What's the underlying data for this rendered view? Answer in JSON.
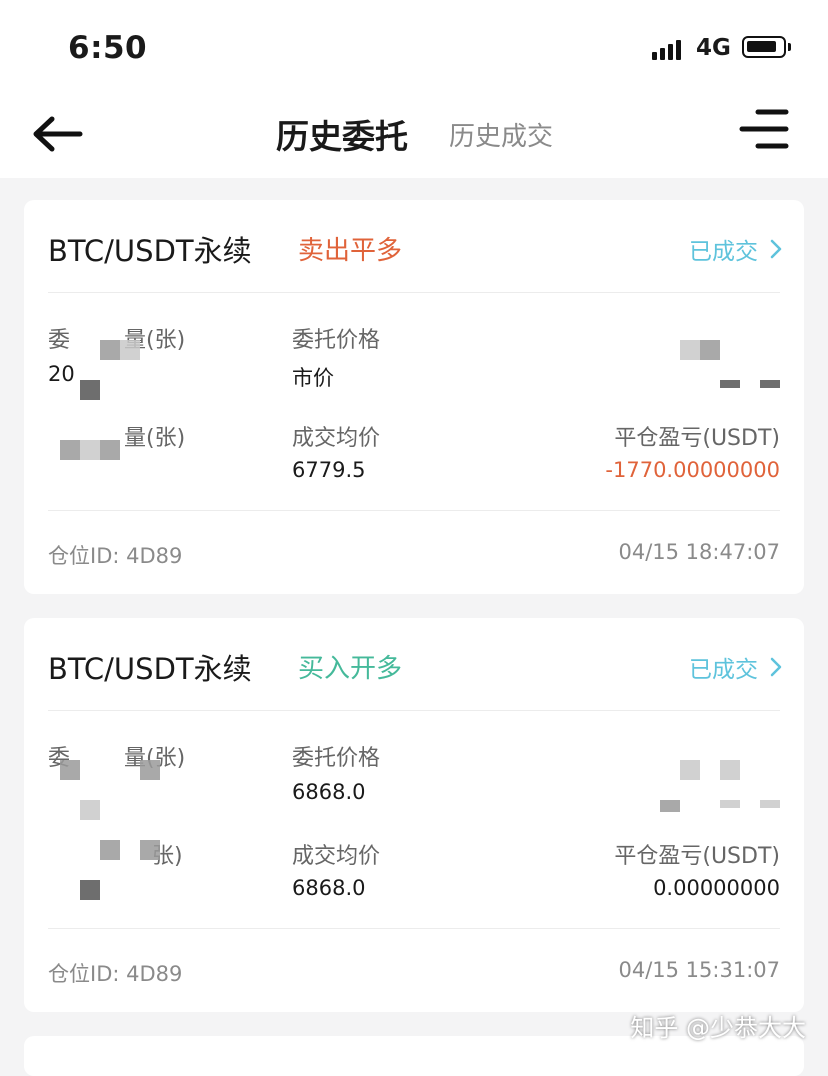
{
  "status_bar": {
    "time": "6:50",
    "network": "4G"
  },
  "nav": {
    "tab_active": "历史委托",
    "tab_inactive": "历史成交",
    "back_icon": "arrow-left-icon",
    "menu_icon": "filter-menu-icon"
  },
  "colors": {
    "sell": "#e0633a",
    "buy": "#45b99a",
    "status_link": "#5ec3dc",
    "loss": "#e0633a"
  },
  "orders": [
    {
      "pair": "BTC/USDT永续",
      "side": "卖出平多",
      "status": "已成交",
      "status_icon": "chevron-right-icon",
      "label_qty": "委托数量(张)",
      "label_qty_visible": [
        "委",
        "量(张)"
      ],
      "qty_visible": "20",
      "label_price": "委托价格",
      "price": "市价",
      "label_filled_visible": "量(张)",
      "label_avg": "成交均价",
      "avg": "6779.5",
      "label_pnl": "平仓盈亏(USDT)",
      "pnl": "-1770.00000000",
      "position_id": "仓位ID: 4D89",
      "time": "04/15 18:47:07"
    },
    {
      "pair": "BTC/USDT永续",
      "side": "买入开多",
      "status": "已成交",
      "status_icon": "chevron-right-icon",
      "label_qty_visible": [
        "委",
        "量(张)"
      ],
      "label_price": "委托价格",
      "price": "6868.0",
      "label_filled_visible": "张)",
      "label_avg": "成交均价",
      "avg": "6868.0",
      "label_pnl": "平仓盈亏(USDT)",
      "pnl": "0.00000000",
      "position_id": "仓位ID: 4D89",
      "time": "04/15 15:31:07"
    }
  ],
  "watermark": "知乎 @少恭大大"
}
